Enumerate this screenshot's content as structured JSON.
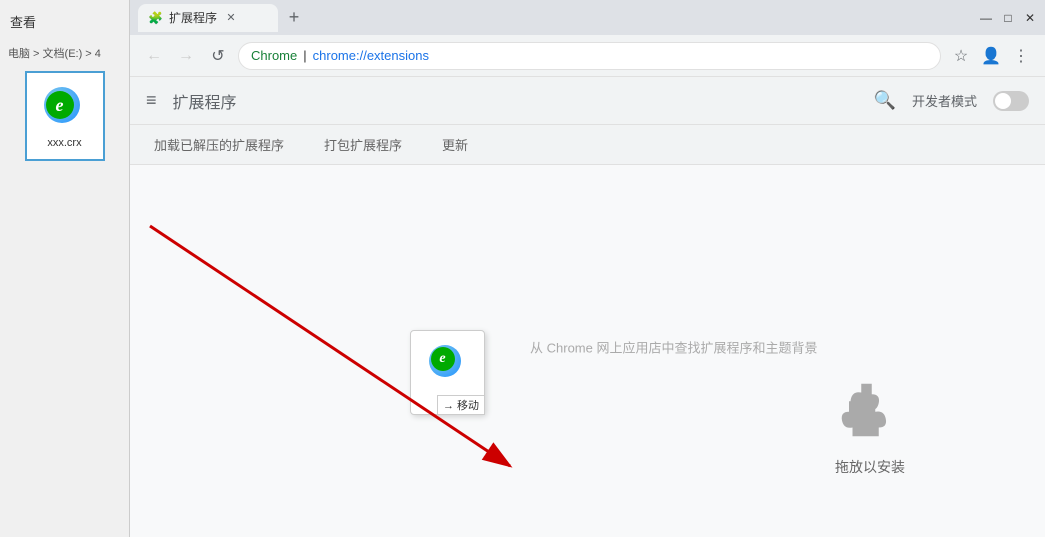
{
  "leftPanel": {
    "viewLabel": "查看",
    "breadcrumb": "电脑 > 文档(E:) > 4",
    "fileItem": {
      "name": "xxx.crx",
      "iconAlt": "crx file icon"
    }
  },
  "browser": {
    "tab": {
      "label": "扩展程序",
      "iconUnicode": "🧩"
    },
    "newTabTitle": "+",
    "windowControls": {
      "minimize": "—",
      "maximize": "□",
      "close": "✕"
    },
    "addressBar": {
      "back": "←",
      "forward": "→",
      "reload": "↺",
      "protocol": "chrome",
      "separator": " | ",
      "url": "chrome://extensions",
      "star": "☆",
      "accountIcon": "👤",
      "menuIcon": "⋮"
    },
    "extensionsPage": {
      "menuIcon": "≡",
      "title": "扩展程序",
      "searchIcon": "🔍",
      "devModeLabel": "开发者模式",
      "actionBar": {
        "btn1": "加载已解压的扩展程序",
        "btn2": "打包扩展程序",
        "btn3": "更新"
      },
      "dropHintText": "从 Chrome 网上应用店中查找扩展程序和主题背景",
      "dropZone": {
        "icon": "puzzle",
        "label": "拖放以安装"
      },
      "draggingFile": {
        "moveBadge": "→ 移动"
      }
    }
  },
  "arrow": {
    "color": "#cc0000"
  }
}
